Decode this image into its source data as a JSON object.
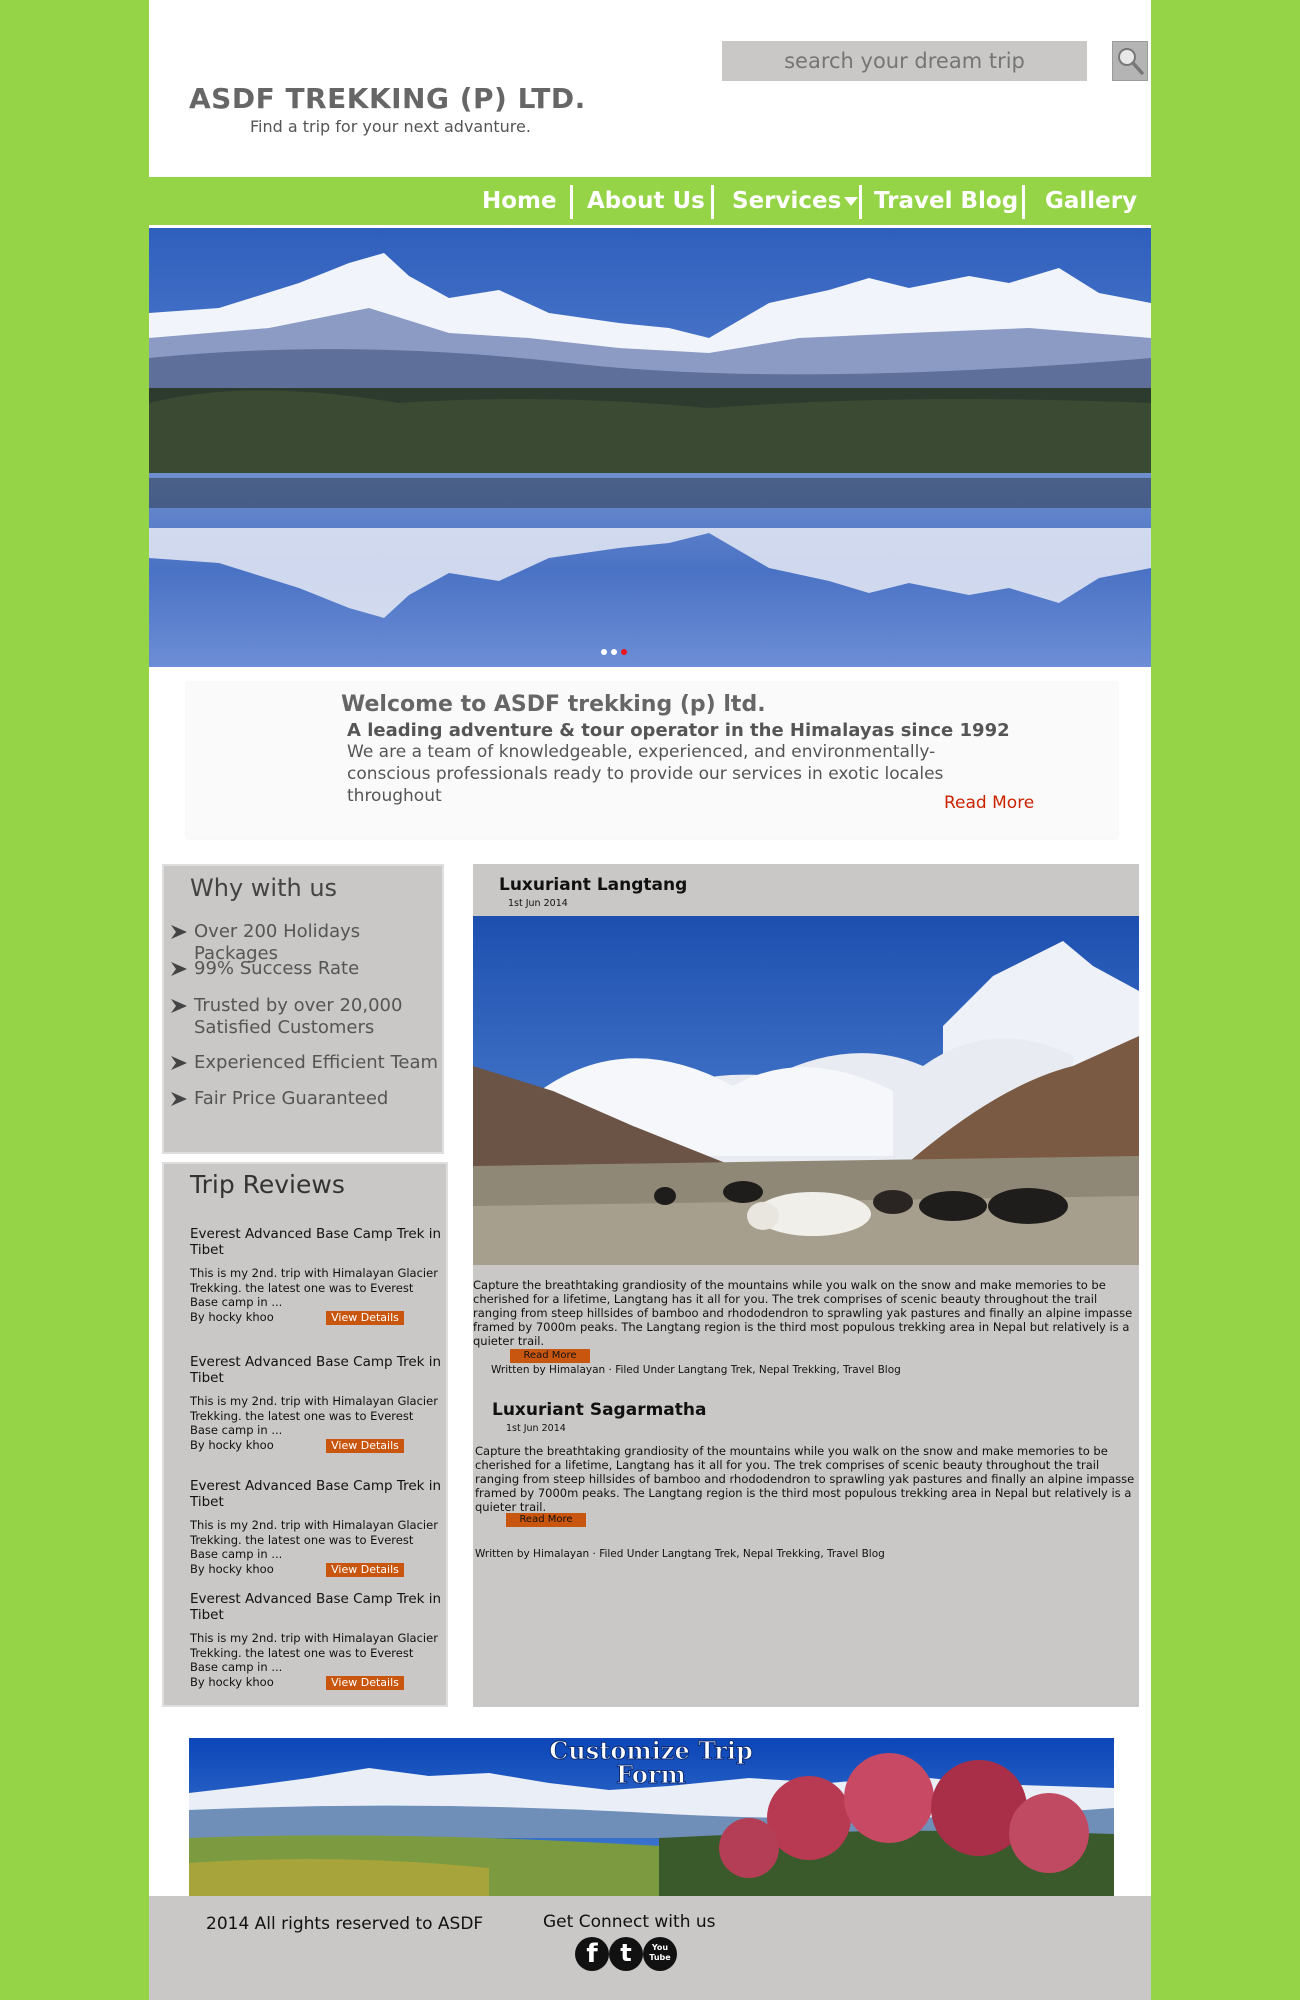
{
  "header": {
    "company_name": "ASDF TREKKING (P) LTD.",
    "tagline": "Find a trip for your next advanture.",
    "search_placeholder": "search your dream trip",
    "search_icon": "magnifier-icon"
  },
  "nav": {
    "items": [
      "Home",
      "About Us",
      "Services",
      "Travel Blog",
      "Gallery"
    ]
  },
  "hero": {
    "slides": 3,
    "active_slide": 3,
    "colors": {
      "dot_active": "#e8161b",
      "dot_inactive": "#ffffff"
    }
  },
  "welcome": {
    "title": "Welcome to ASDF trekking (p) ltd.",
    "subtitle": "A leading adventure & tour operator in the Himalayas since 1992",
    "body": "We are a team of knowledgeable, experienced, and environmentally-conscious professionals ready to provide our services in exotic locales throughout",
    "read_more": "Read More"
  },
  "why": {
    "title": "Why with us",
    "items": [
      "Over 200 Holidays Packages",
      "99% Success Rate",
      "Trusted by over 20,000 Satisfied Customers",
      "Experienced Efficient Team",
      "Fair Price Guaranteed"
    ]
  },
  "reviews": {
    "title": "Trip Reviews",
    "items": [
      {
        "trip": "Everest Advanced Base Camp Trek in Tibet",
        "text": "This is my 2nd. trip with Himalayan Glacier Trekking. the latest one was to Everest Base camp in ...",
        "author": "By hocky khoo",
        "button": "View Details"
      },
      {
        "trip": "Everest Advanced Base Camp Trek in Tibet",
        "text": "This is my 2nd. trip with Himalayan Glacier Trekking. the latest one was to Everest Base camp in ...",
        "author": "By hocky khoo",
        "button": "View Details"
      },
      {
        "trip": "Everest Advanced Base Camp Trek in Tibet",
        "text": "This is my 2nd. trip with Himalayan Glacier Trekking. the latest one was to Everest Base camp in ...",
        "author": "By hocky khoo",
        "button": "View Details"
      },
      {
        "trip": "Everest Advanced Base Camp Trek in Tibet",
        "text": "This is my 2nd. trip with Himalayan Glacier Trekking. the latest one was to Everest Base camp in ...",
        "author": "By hocky khoo",
        "button": "View Details"
      }
    ]
  },
  "articles": [
    {
      "title": "Luxuriant Langtang",
      "date": "1st Jun 2014",
      "body": "Capture the breathtaking grandiosity of the mountains while you walk on the snow and make memories to be cherished for a lifetime, Langtang has it all for you. The trek comprises of scenic beauty throughout the trail ranging from steep hillsides of bamboo and rhododendron to sprawling yak pastures and finally an alpine impasse framed by 7000m peaks. The Langtang region is the third most populous trekking area in Nepal but relatively is a quieter trail.",
      "button": "Read More",
      "meta": "Written by Himalayan · Filed Under Langtang Trek, Nepal Trekking, Travel Blog"
    },
    {
      "title": "Luxuriant Sagarmatha",
      "date": "1st Jun 2014",
      "body": "Capture the breathtaking grandiosity of the mountains while you walk on the snow and make memories to be cherished for a lifetime, Langtang has it all for you. The trek comprises of scenic beauty throughout the trail ranging from steep hillsides of bamboo and rhododendron to sprawling yak pastures and finally an alpine impasse framed by 7000m peaks. The Langtang region is the third most populous trekking area in Nepal but relatively is a quieter trail.",
      "button": "Read More",
      "meta": "Written by Himalayan · Filed Under Langtang Trek, Nepal Trekking, Travel Blog"
    }
  ],
  "banner": {
    "title_line1": "Customize Trip",
    "title_line2": "Form"
  },
  "footer": {
    "copyright": "2014 All rights reserved to ASDF",
    "connect": "Get Connect with us",
    "social": [
      {
        "icon": "facebook-icon",
        "glyph": "f"
      },
      {
        "icon": "twitter-icon",
        "glyph": "t"
      },
      {
        "icon": "youtube-icon",
        "glyph": "You Tube"
      }
    ]
  },
  "colors": {
    "background": "#94d446",
    "panel_gray": "#c9c8c6",
    "button_orange": "#c9560e",
    "read_more_red": "#cc2200"
  }
}
